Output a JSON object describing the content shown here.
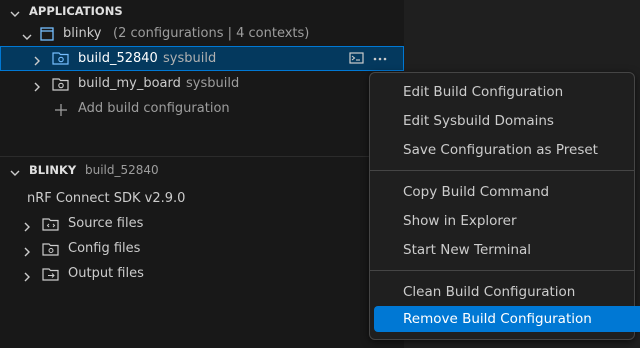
{
  "applications": {
    "header": "APPLICATIONS",
    "app": {
      "name": "blinky",
      "detail": "(2 configurations | 4 contexts)"
    },
    "builds": [
      {
        "name": "build_52840",
        "tag": "sysbuild"
      },
      {
        "name": "build_my_board",
        "tag": "sysbuild"
      }
    ],
    "add_label": "Add build configuration"
  },
  "blinky_section": {
    "header": "BLINKY",
    "build": "build_52840",
    "sdk": "nRF Connect SDK v2.9.0",
    "folders": [
      "Source files",
      "Config files",
      "Output files"
    ]
  },
  "context_menu": {
    "group1": [
      "Edit Build Configuration",
      "Edit Sysbuild Domains",
      "Save Configuration as Preset"
    ],
    "group2": [
      "Copy Build Command",
      "Show in Explorer",
      "Start New Terminal"
    ],
    "group3": [
      "Clean Build Configuration",
      "Remove Build Configuration"
    ]
  },
  "colors": {
    "accent": "#0078d4",
    "selection": "#04395e",
    "icon": "#75beff"
  }
}
